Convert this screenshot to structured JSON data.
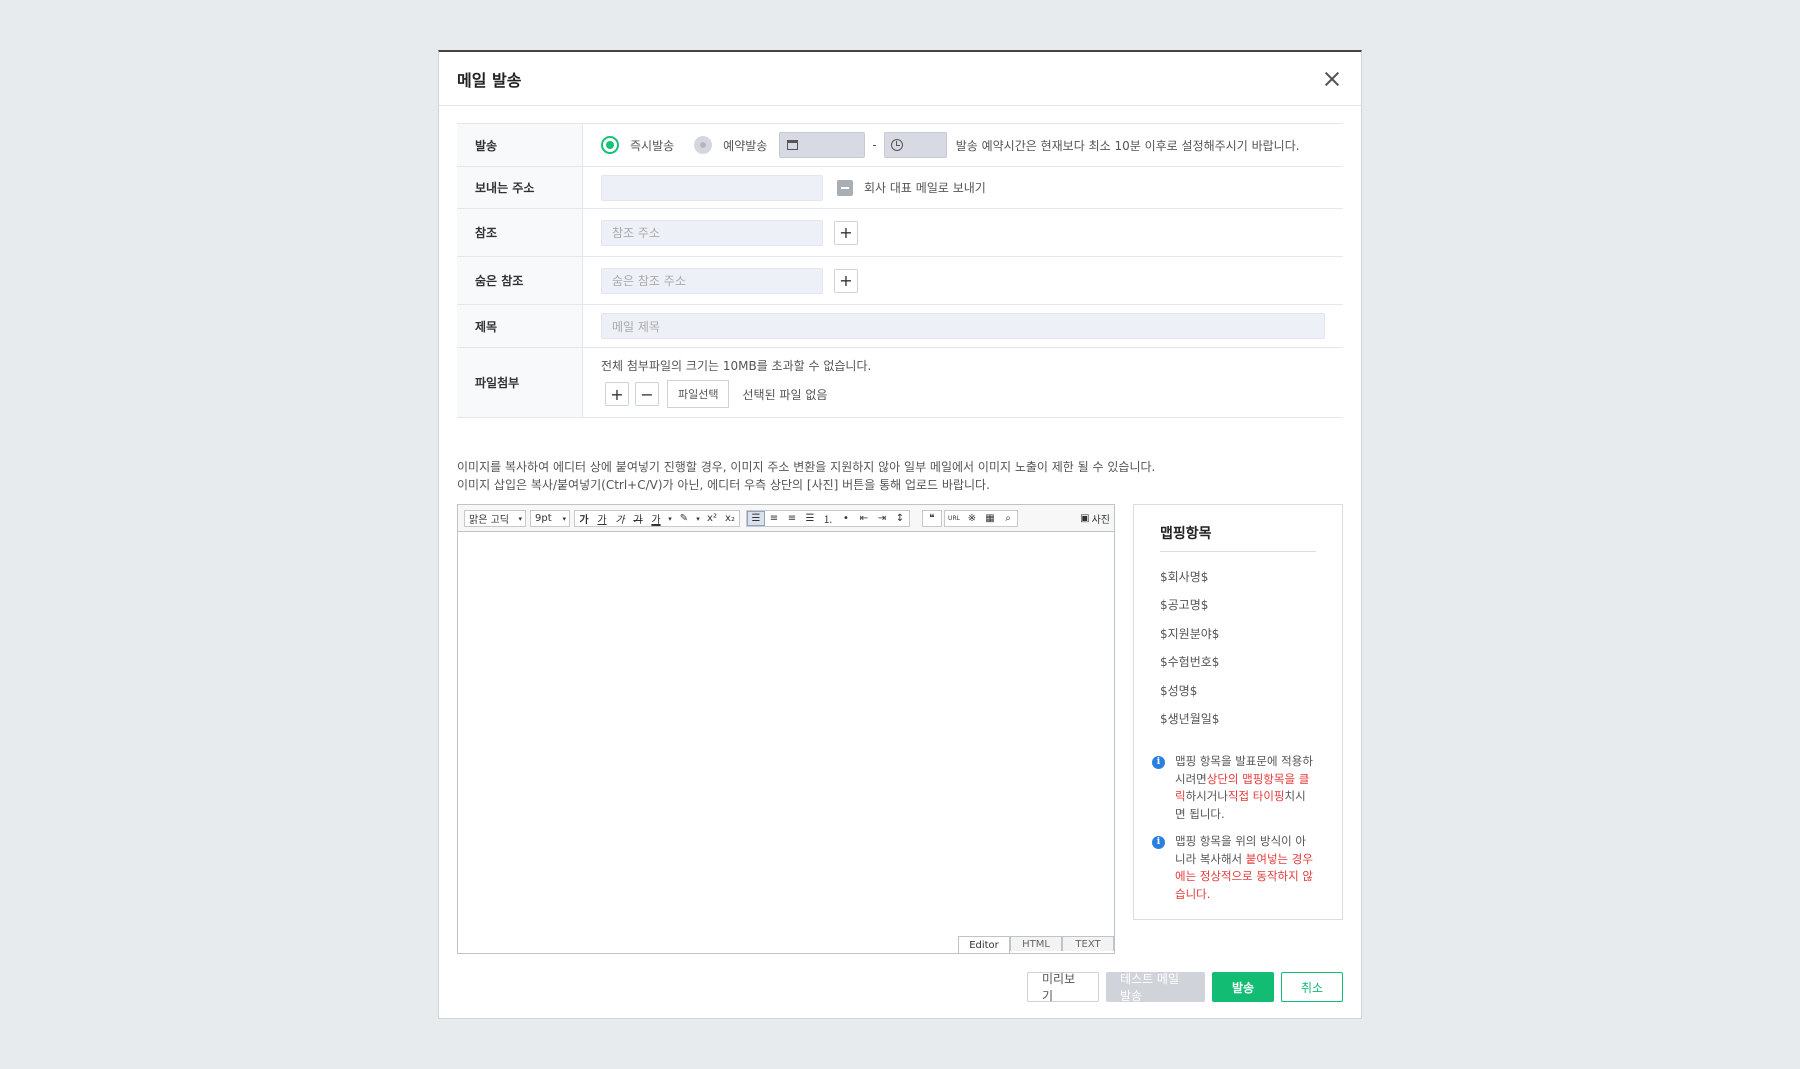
{
  "modal": {
    "title": "메일 발송"
  },
  "form": {
    "send": {
      "label": "발송",
      "options": [
        "즉시발송",
        "예약발송"
      ],
      "selected": "즉시발송",
      "separator": "-",
      "hint": "발송 예약시간은 현재보다 최소 10분 이후로 설정해주시기 바랍니다."
    },
    "from": {
      "label": "보내는 주소",
      "value": "",
      "checkbox_label": "회사 대표 메일로 보내기"
    },
    "cc": {
      "label": "참조",
      "placeholder": "참조 주소"
    },
    "bcc": {
      "label": "숨은 참조",
      "placeholder": "숨은 참조 주소"
    },
    "subject": {
      "label": "제목",
      "placeholder": "메일 제목"
    },
    "attach": {
      "label": "파일첨부",
      "info": "전체 첨부파일의 크기는 10MB를 초과할 수 없습니다.",
      "add": "+",
      "remove": "−",
      "select_label": "파일선택",
      "status": "선택된 파일 없음"
    }
  },
  "notice": {
    "line1": "이미지를 복사하여 에디터 상에 붙여넣기 진행할 경우, 이미지 주소 변환을 지원하지 않아 일부 메일에서 이미지 노출이 제한 될 수 있습니다.",
    "line2": "이미지 삽입은 복사/붙여넣기(Ctrl+C/V)가 아닌, 에디터 우측 상단의 [사진] 버튼을 통해 업로드 바랍니다."
  },
  "editor": {
    "font": "맑은 고딕",
    "size": "9pt",
    "format_buttons": [
      "가",
      "가",
      "가",
      "가",
      "가"
    ],
    "photo_label": "사진",
    "tabs": [
      "Editor",
      "HTML",
      "TEXT"
    ],
    "active_tab": "Editor"
  },
  "mapping": {
    "title": "맵핑항목",
    "items": [
      "$회사명$",
      "$공고명$",
      "$지원분야$",
      "$수험번호$",
      "$성명$",
      "$생년월일$"
    ],
    "note1": {
      "a": "맵핑 항목을 발표문에 적용하시려면",
      "b": "상단의 맵핑항목을 클릭",
      "c": "하시거나",
      "d": "직접 타이핑",
      "e": "치시면 됩니다."
    },
    "note2": {
      "a": "맵핑 항목을 위의 방식이 아니라 복사해서 ",
      "b": "붙여넣는 경우에는 정상적으로 동작하지 않습니다."
    }
  },
  "footer": {
    "preview": "미리보기",
    "test": "테스트 메일 발송",
    "send": "발송",
    "cancel": "취소"
  },
  "colors": {
    "accent": "#12bc72",
    "warning": "#e53a3a",
    "info": "#2a7fe3"
  }
}
